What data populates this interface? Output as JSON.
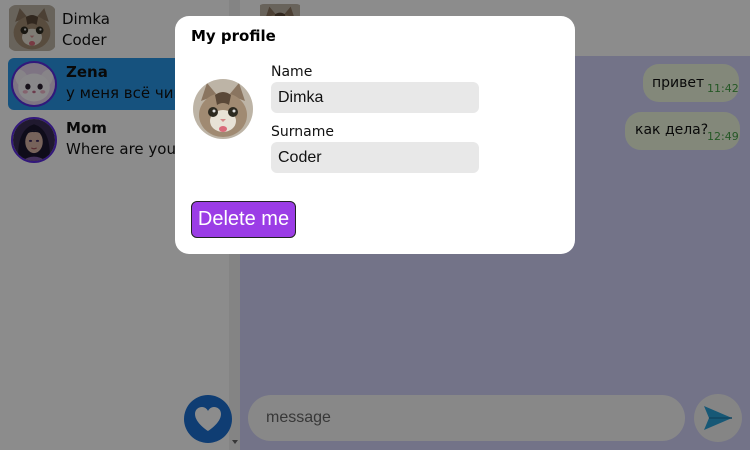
{
  "current_user": {
    "first_name": "Dimka",
    "last_name": "Coder",
    "avatar": "cat-photo"
  },
  "contacts": [
    {
      "name": "Zena",
      "last_message": "у меня всё чик",
      "avatar": "plush-toy-photo",
      "active": true
    },
    {
      "name": "Mom",
      "last_message": "Where are you?",
      "avatar": "fantasy-woman-portrait",
      "active": false
    }
  ],
  "messages": [
    {
      "text": "привет",
      "time": "11:42"
    },
    {
      "text": "как дела?",
      "time": "12:49"
    }
  ],
  "composer": {
    "placeholder": "message"
  },
  "icons": {
    "like": "heart-icon",
    "send": "send-arrow-icon"
  },
  "modal": {
    "title": "My profile",
    "name_label": "Name",
    "name_value": "Dimka",
    "surname_label": "Surname",
    "surname_value": "Coder",
    "delete_label": "Delete me"
  },
  "colors": {
    "active_contact": "#2896e6",
    "chat_background": "#d2d2f7",
    "bubble": "#eef8df",
    "timestamp": "#46a046",
    "delete_button": "#9b3de6",
    "heart_button": "#1c6fd1",
    "send_icon": "#2aa1d8"
  }
}
